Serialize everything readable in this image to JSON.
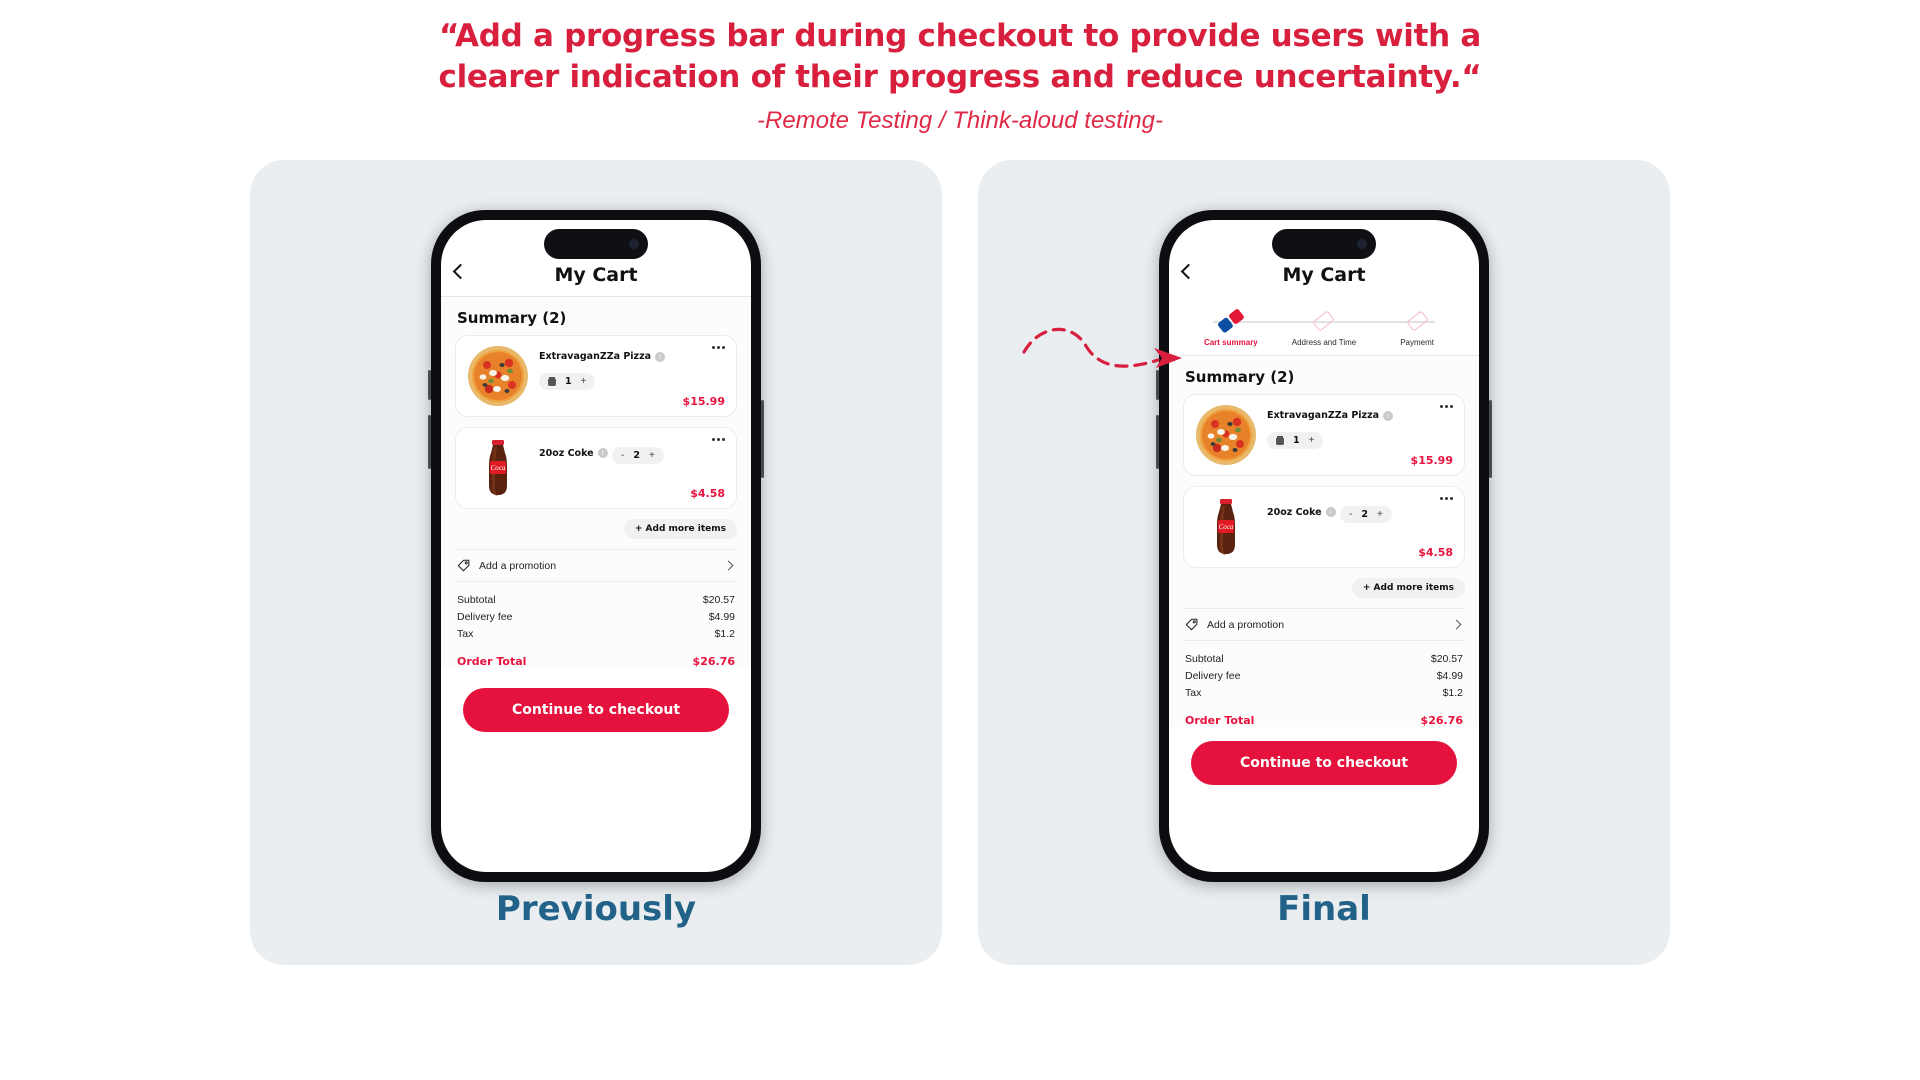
{
  "header": {
    "quote_line1": "“Add a progress bar during checkout to provide users with a",
    "quote_line2": "clearer indication of their progress and reduce uncertainty.“",
    "source": "-Remote Testing / Think-aloud testing-"
  },
  "colors": {
    "brand_red": "#e4123c",
    "quote_red": "#d81f3d",
    "caption_blue": "#226288",
    "panel_bg": "#eaeef1",
    "domino_blue": "#0b4ea2"
  },
  "panels": [
    {
      "caption": "Previously",
      "has_stepper": false
    },
    {
      "caption": "Final",
      "has_stepper": true
    }
  ],
  "app": {
    "title": "My Cart",
    "back_icon": "chevron-left-icon",
    "summary_title": "Summary (2)",
    "add_more_label": "+ Add more items",
    "promotion_label": "Add a promotion",
    "promotion_icon": "tag-icon",
    "promotion_chevron": "chevron-right-icon",
    "checkout_label": "Continue to checkout",
    "order_total_label": "Order Total",
    "order_total_value": "$26.76",
    "items": [
      {
        "name": "ExtravaganZZa Pizza",
        "info_icon": "info-icon",
        "kebab_icon": "more-options-icon",
        "qty": "1",
        "decrement_icon": "trash-icon",
        "increment_label": "+",
        "price": "$15.99",
        "image": "pizza-image"
      },
      {
        "name": "20oz Coke",
        "info_icon": "info-icon",
        "kebab_icon": "more-options-icon",
        "qty": "2",
        "decrement_label": "-",
        "increment_label": "+",
        "price": "$4.58",
        "image": "coke-bottle-image"
      }
    ],
    "totals": [
      {
        "label": "Subtotal",
        "value": "$20.57"
      },
      {
        "label": "Delivery fee",
        "value": "$4.99"
      },
      {
        "label": "Tax",
        "value": "$1.2"
      }
    ]
  },
  "stepper": {
    "steps": [
      {
        "label": "Cart summary",
        "state": "active",
        "marker": "domino-logo-icon"
      },
      {
        "label": "Address and Time",
        "state": "inactive",
        "marker": "domino-outline-icon"
      },
      {
        "label": "Paymemt",
        "state": "inactive",
        "marker": "domino-outline-icon"
      }
    ]
  },
  "annotation": {
    "icon": "dashed-curved-arrow-icon"
  }
}
